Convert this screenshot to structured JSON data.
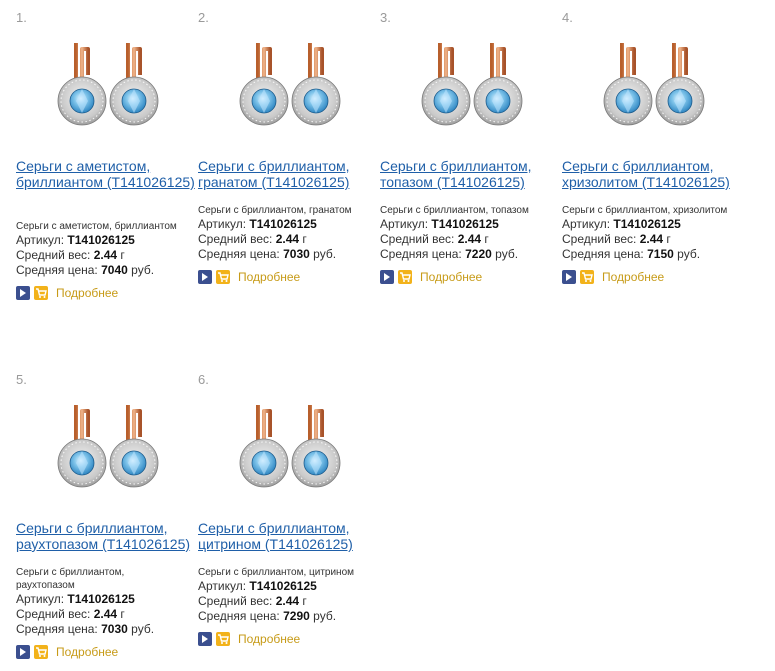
{
  "labels": {
    "article": "Артикул:",
    "weight": "Средний вес:",
    "price": "Средняя цена:",
    "currency": "руб.",
    "more": "Подробнее"
  },
  "colors": {
    "link": "#1f5fa8",
    "more": "#c79b18",
    "arrow_btn": "#3b4f8f",
    "cart_btn": "#f2b21a"
  },
  "products": [
    {
      "num": "1.",
      "title": "Серьги с аметистом, бриллиантом (Т141026125)",
      "desc": "Серьги с аметистом, бриллиантом",
      "article": "Т141026125",
      "weight": "2.44",
      "weight_unit": "г",
      "price": "7040"
    },
    {
      "num": "2.",
      "title": "Серьги с бриллиантом, гранатом (Т141026125)",
      "desc": "Серьги с бриллиантом, гранатом",
      "article": "Т141026125",
      "weight": "2.44",
      "weight_unit": "г",
      "price": "7030"
    },
    {
      "num": "3.",
      "title": "Серьги с бриллиантом, топазом (Т141026125)",
      "desc": "Серьги с бриллиантом, топазом",
      "article": "Т141026125",
      "weight": "2.44",
      "weight_unit": "г",
      "price": "7220"
    },
    {
      "num": "4.",
      "title": "Серьги с бриллиантом, хризолитом (Т141026125)",
      "desc": "Серьги с бриллиантом, хризолитом",
      "article": "Т141026125",
      "weight": "2.44",
      "weight_unit": "г",
      "price": "7150"
    },
    {
      "num": "5.",
      "title": "Серьги с бриллиантом, раухтопазом (Т141026125)",
      "desc": "Серьги с бриллиантом, раухтопазом",
      "article": "Т141026125",
      "weight": "2.44",
      "weight_unit": "г",
      "price": "7030"
    },
    {
      "num": "6.",
      "title": "Серьги с бриллиантом, цитрином (Т141026125)",
      "desc": "Серьги с бриллиантом, цитрином",
      "article": "Т141026125",
      "weight": "2.44",
      "weight_unit": "г",
      "price": "7290"
    }
  ]
}
